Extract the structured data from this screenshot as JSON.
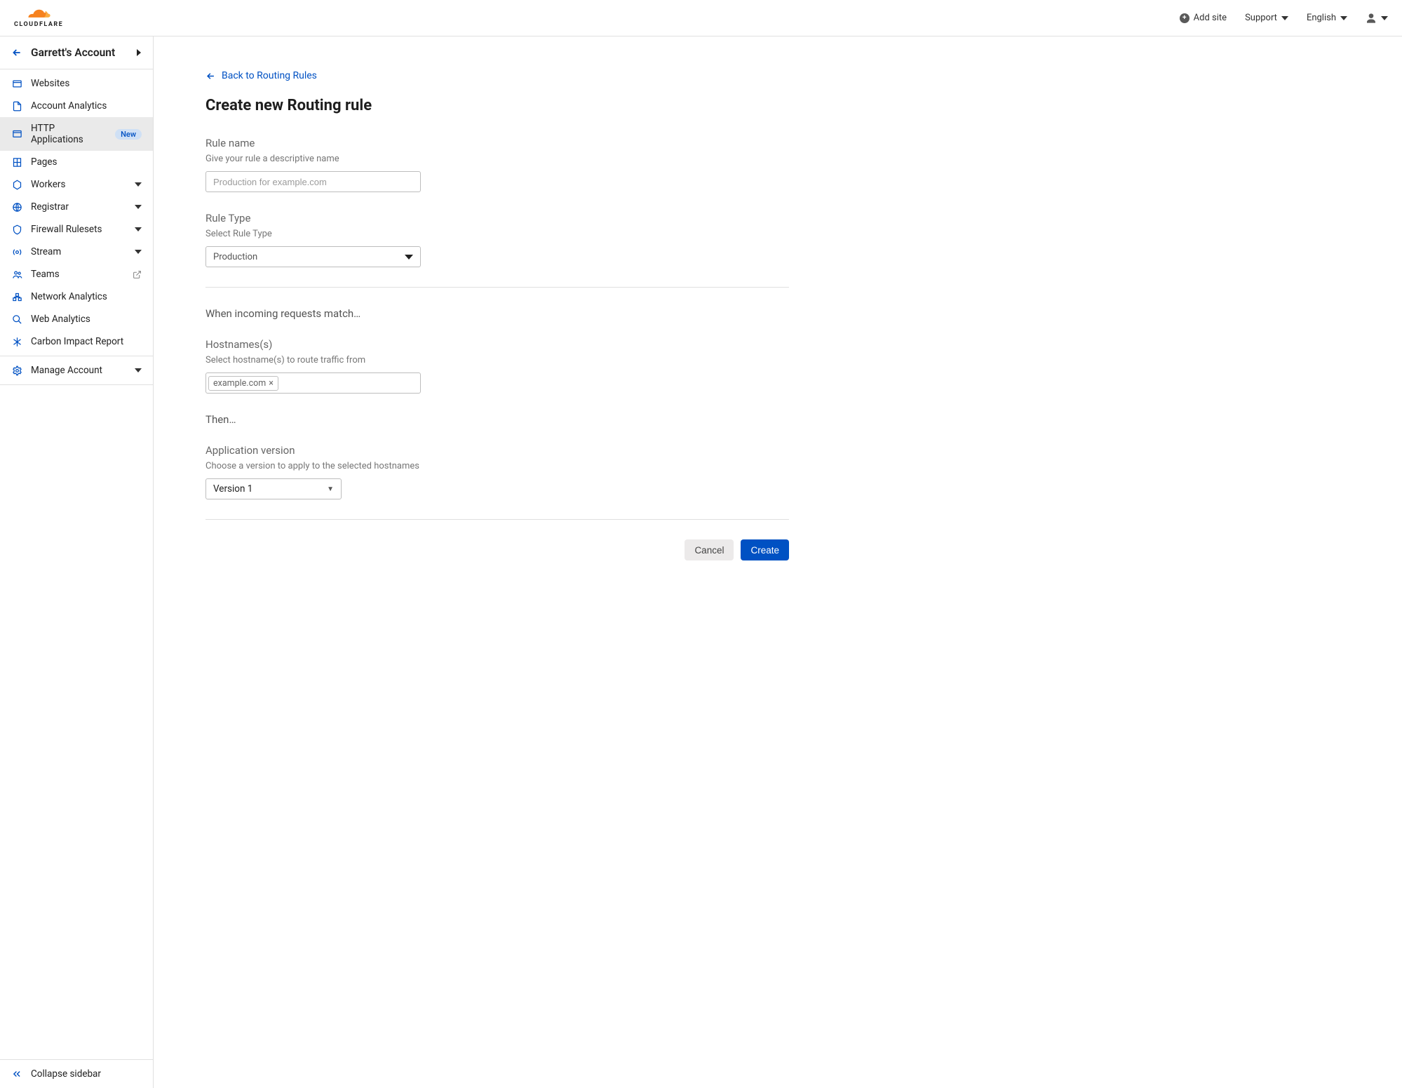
{
  "header": {
    "add_site": "Add site",
    "support": "Support",
    "language": "English"
  },
  "sidebar": {
    "account": "Garrett's Account",
    "collapse": "Collapse sidebar",
    "manage": "Manage Account",
    "items": [
      {
        "label": "Websites"
      },
      {
        "label": "Account Analytics"
      },
      {
        "label": "HTTP Applications",
        "badge": "New"
      },
      {
        "label": "Pages"
      },
      {
        "label": "Workers"
      },
      {
        "label": "Registrar"
      },
      {
        "label": "Firewall Rulesets"
      },
      {
        "label": "Stream"
      },
      {
        "label": "Teams"
      },
      {
        "label": "Network Analytics"
      },
      {
        "label": "Web Analytics"
      },
      {
        "label": "Carbon Impact Report"
      }
    ]
  },
  "main": {
    "back": "Back to Routing Rules",
    "title": "Create new Routing rule",
    "rule_name": {
      "label": "Rule name",
      "help": "Give your rule a descriptive name",
      "placeholder": "Production for example.com"
    },
    "rule_type": {
      "label": "Rule Type",
      "help": "Select Rule Type",
      "value": "Production"
    },
    "match_heading": "When incoming requests match…",
    "hostnames": {
      "label": "Hostnames(s)",
      "help": "Select hostname(s) to route traffic from",
      "tag": "example.com"
    },
    "then_heading": "Then…",
    "version": {
      "label": "Application version",
      "help": "Choose a version to apply to the selected hostnames",
      "value": "Version 1"
    },
    "cancel": "Cancel",
    "create": "Create"
  }
}
